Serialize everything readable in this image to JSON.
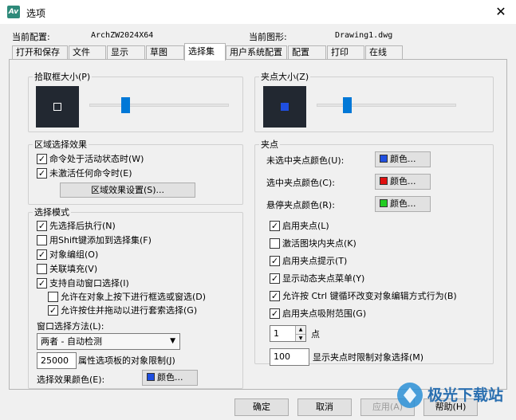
{
  "window": {
    "title": "选项",
    "app_icon_text": "Av"
  },
  "header": {
    "current_profile_label": "当前配置:",
    "current_profile_value": "ArchZW2024X64",
    "current_drawing_label": "当前图形:",
    "current_drawing_value": "Drawing1.dwg"
  },
  "tabs": [
    {
      "label": "打开和保存"
    },
    {
      "label": "文件"
    },
    {
      "label": "显示"
    },
    {
      "label": "草图"
    },
    {
      "label": "选择集"
    },
    {
      "label": "用户系统配置"
    },
    {
      "label": "配置"
    },
    {
      "label": "打印"
    },
    {
      "label": "在线"
    }
  ],
  "active_tab": "选择集",
  "pickbox": {
    "title": "拾取框大小(P)",
    "slider_level": 0.3
  },
  "gripsize": {
    "title": "夹点大小(Z)",
    "slider_level": 0.3
  },
  "region_effect": {
    "title": "区域选择效果",
    "options": [
      {
        "label": "命令处于活动状态时(W)",
        "checked": true
      },
      {
        "label": "未激活任何命令时(E)",
        "checked": true
      }
    ],
    "settings_button": "区域效果设置(S)..."
  },
  "selection_mode": {
    "title": "选择模式",
    "options": [
      {
        "label": "先选择后执行(N)",
        "checked": true
      },
      {
        "label": "用Shift键添加到选择集(F)",
        "checked": false
      },
      {
        "label": "对象编组(O)",
        "checked": true
      },
      {
        "label": "关联填充(V)",
        "checked": false
      },
      {
        "label": "支持自动窗口选择(I)",
        "checked": true
      }
    ],
    "sub_options": [
      {
        "label": "允许在对象上按下进行框选或窗选(D)",
        "checked": false
      },
      {
        "label": "允许按住并拖动以进行套索选择(G)",
        "checked": true
      }
    ],
    "window_method_label": "窗口选择方法(L):",
    "window_method_value": "两者 - 自动检测",
    "object_limit_value": "25000",
    "object_limit_label": "属性选项板的对象限制(J)",
    "effect_color_label": "选择效果颜色(E):",
    "effect_color_button": "颜色...",
    "effect_color": "#1f4fe0"
  },
  "grips": {
    "title": "夹点",
    "unselected_label": "未选中夹点颜色(U):",
    "selected_label": "选中夹点颜色(C):",
    "hover_label": "悬停夹点颜色(R):",
    "color_button": "颜色...",
    "unselected_color": "#1f4fe0",
    "selected_color": "#e01010",
    "hover_color": "#22cc22",
    "options": [
      {
        "label": "启用夹点(L)",
        "checked": true
      },
      {
        "label": "激活图块内夹点(K)",
        "checked": false
      },
      {
        "label": "启用夹点提示(T)",
        "checked": true
      },
      {
        "label": "显示动态夹点菜单(Y)",
        "checked": true
      },
      {
        "label": "允许按 Ctrl 键循环改变对象编辑方式行为(B)",
        "checked": true
      },
      {
        "label": "启用夹点吸附范围(G)",
        "checked": true
      }
    ],
    "snap_range_value": "1",
    "snap_range_unit": "点",
    "display_limit_value": "100",
    "display_limit_label": "显示夹点时限制对象选择(M)"
  },
  "buttons": {
    "ok": "确定",
    "cancel": "取消",
    "apply": "应用(A)",
    "help": "帮助(H)"
  },
  "watermark_text": "极光下载站"
}
